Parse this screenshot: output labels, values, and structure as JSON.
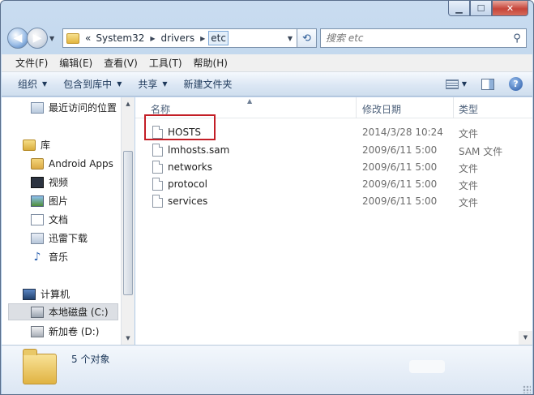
{
  "address": {
    "chevrons": "«",
    "crumbs": [
      "System32",
      "drivers",
      "etc"
    ]
  },
  "search": {
    "placeholder": "搜索 etc"
  },
  "menu": [
    "文件(F)",
    "编辑(E)",
    "查看(V)",
    "工具(T)",
    "帮助(H)"
  ],
  "toolbar": {
    "organize": "组织",
    "include_library": "包含到库中",
    "share": "共享",
    "new_folder": "新建文件夹"
  },
  "nav": {
    "recent": "最近访问的位置",
    "library": "库",
    "android_apps": "Android Apps",
    "video": "视频",
    "pictures": "图片",
    "documents": "文档",
    "xunlei": "迅雷下载",
    "music": "音乐",
    "computer": "计算机",
    "local_disk": "本地磁盘 (C:)",
    "new_volume": "新加卷 (D:)"
  },
  "columns": {
    "name": "名称",
    "modified": "修改日期",
    "type": "类型"
  },
  "files": [
    {
      "name": "HOSTS",
      "date": "2014/3/28 10:24",
      "type": "文件"
    },
    {
      "name": "lmhosts.sam",
      "date": "2009/6/11 5:00",
      "type": "SAM 文件"
    },
    {
      "name": "networks",
      "date": "2009/6/11 5:00",
      "type": "文件"
    },
    {
      "name": "protocol",
      "date": "2009/6/11 5:00",
      "type": "文件"
    },
    {
      "name": "services",
      "date": "2009/6/11 5:00",
      "type": "文件"
    }
  ],
  "status": {
    "count": "5 个对象"
  },
  "colors": {
    "highlight_box": "#c31e26",
    "accent": "#1e395b"
  }
}
